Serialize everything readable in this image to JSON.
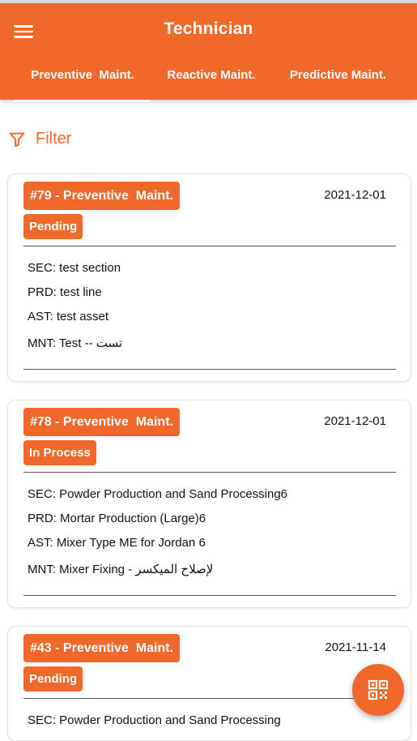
{
  "app": {
    "title": "Technician"
  },
  "tabs": [
    {
      "label": "Preventive  Maint."
    },
    {
      "label": "Reactive Maint."
    },
    {
      "label": "Predictive Maint."
    }
  ],
  "filter": {
    "label": "Filter"
  },
  "cards": [
    {
      "id": "#79 - Preventive  Maint.",
      "date": "2021-12-01",
      "status": "Pending",
      "sec": "SEC: test section",
      "prd": "PRD: test line",
      "ast": "AST: test asset",
      "mnt": "MNT: Test -- تست"
    },
    {
      "id": "#78 - Preventive  Maint.",
      "date": "2021-12-01",
      "status": "In Process",
      "sec": "SEC: Powder Production and Sand Processing6",
      "prd": "PRD: Mortar Production (Large)6",
      "ast": "AST: Mixer Type ME for Jordan 6",
      "mnt": "MNT: Mixer Fixing - لإصلاح الميكسر"
    },
    {
      "id": "#43 - Preventive  Maint.",
      "date": "2021-11-14",
      "status": "Pending",
      "sec": "SEC: Powder Production and Sand Processing"
    }
  ],
  "colors": {
    "accent": "#f0692a"
  },
  "icons": {
    "menu": "hamburger-icon",
    "filter": "funnel-icon",
    "fab": "qr-code-icon"
  }
}
